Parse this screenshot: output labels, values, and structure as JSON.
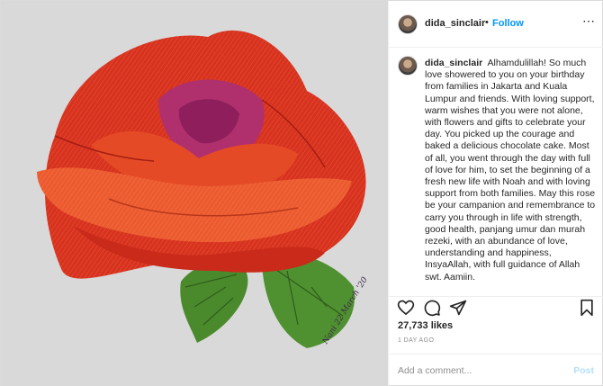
{
  "post": {
    "author": {
      "username": "dida_sinclair",
      "separator": "•",
      "follow_label": "Follow",
      "more_icon": "ellipsis-icon"
    },
    "artwork": {
      "signature": "Nani 22 March '20",
      "colors": {
        "paper": "#d9d9d9",
        "petal_red": "#d8321d",
        "petal_orange": "#ec5a2e",
        "petal_magenta": "#b0306e",
        "leaf_green": "#4a8a2c"
      }
    },
    "caption": {
      "username": "dida_sinclair",
      "text": "Alhamdulillah! So much love showered to you on your birthday from families in Jakarta and Kuala Lumpur and friends. With loving support, warm wishes that you were not alone, with flowers and gifts to celebrate your day. You picked up the courage and baked a delicious chocolate cake. Most of all, you went through the day with full of love for him, to set the beginning of a fresh new life with Noah and with loving support from both families. May this rose be your campanion and remembrance to carry you through in life with strength, good health, panjang umur dan murah rezeki, with an abundance of love, understanding and happiness, InsyaAllah, with full guidance of Allah swt. Aamiin."
    },
    "actions": {
      "icons": [
        "heart-icon",
        "comment-icon",
        "share-icon",
        "bookmark-icon"
      ]
    },
    "likes": "27,733 likes",
    "time_ago": "1 DAY AGO",
    "comment_box": {
      "placeholder": "Add a comment...",
      "post_label": "Post"
    },
    "colors": {
      "link_blue": "#0095f6",
      "post_disabled": "#b2dffc",
      "muted": "#8e8e8e"
    }
  }
}
